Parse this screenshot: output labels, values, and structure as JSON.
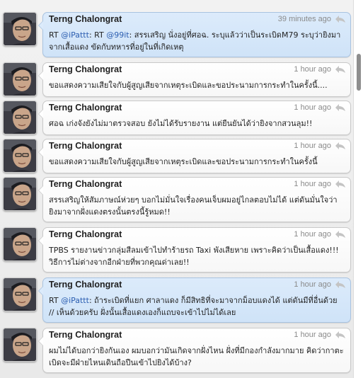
{
  "tweets": [
    {
      "author": "Terng Chalongrat",
      "time": "39 minutes ago",
      "highlighted": true,
      "segments": [
        {
          "t": "RT "
        },
        {
          "t": "@iPattt",
          "m": true
        },
        {
          "t": ": RT "
        },
        {
          "t": "@99it",
          "m": true
        },
        {
          "t": ": สรรเสริญ นั่งอยู่ที่ศอฉ. ระบุแล้วว่าเป็นระเบิดM79 ระบุว่ายิงมาจากเสื้อแดง ขัดกับทหารที่อยู่ในที่เกิดเหตุ"
        }
      ]
    },
    {
      "author": "Terng Chalongrat",
      "time": "1 hour ago",
      "highlighted": false,
      "segments": [
        {
          "t": "ขอแสดงความเสียใจกับผู้สูญเสียจากเหตุระเบิดและขอประนามการกระทำในครั้งนี้...."
        }
      ]
    },
    {
      "author": "Terng Chalongrat",
      "time": "1 hour ago",
      "highlighted": false,
      "segments": [
        {
          "t": "ศอฉ เก่งจังยังไม่มาตรวจสอบ ยังไม่ได้รับรายงาน แต่ยืนยันได้ว่ายิงจากสวนลุม!!"
        }
      ]
    },
    {
      "author": "Terng Chalongrat",
      "time": "1 hour ago",
      "highlighted": false,
      "segments": [
        {
          "t": "ขอแสดงความเสียใจกับผู้สูญเสียจากเหตุระเบิดและขอประนามการกระทำในครั้งนี้"
        }
      ]
    },
    {
      "author": "Terng Chalongrat",
      "time": "1 hour ago",
      "highlighted": false,
      "segments": [
        {
          "t": "สรรเสริญให้สัมภาษณ์ห่วยๆ บอกไม่มั่นใจเรื่องคนเจ็บผมอยู่ไกลตอบไม่ได้ แต่ดันมั่นใจว่ายิงมาจากฝั่งแดงตรงนั้นตรงนี้รู้หมด!!"
        }
      ]
    },
    {
      "author": "Terng Chalongrat",
      "time": "1 hour ago",
      "highlighted": false,
      "segments": [
        {
          "t": "TPBS รายงานข่าวกลุ่มสีลมเข้าไปทำร้ายรถ Taxi พังเสียหาย เพราะคิดว่าเป็นเสื้อแดง!!! วิธีการไม่ต่างจากอีกฝ่ายที่พวกคุณด่าเลย!!"
        }
      ]
    },
    {
      "author": "Terng Chalongrat",
      "time": "1 hour ago",
      "highlighted": true,
      "segments": [
        {
          "t": "RT "
        },
        {
          "t": "@iPattt",
          "m": true
        },
        {
          "t": ": ถ้าระเบิดที่แยก ศาลาแดง ก็มีสิทธิที่จะมาจากม็อบแดงได้ แต่ดันมีที่อื่นด้วย // เห็นด้วยครับ ฝั่งนั้นเสื้อแดงเองก็แถบจะเข้าไปไม่ได้เลย"
        }
      ]
    },
    {
      "author": "Terng Chalongrat",
      "time": "1 hour ago",
      "highlighted": false,
      "segments": [
        {
          "t": "ผมไม่ได้บอกว่ายิงกันเอง ผมบอกว่ามันเกิดจากฝั่งไหน ฝั่งที่มีกองกำลังมากมาย คิดว่ากาตะเบิดจะมีฝ่ายไหนเดินถือปืนเข้าไปยิงได้บ้าง?"
        }
      ]
    }
  ]
}
